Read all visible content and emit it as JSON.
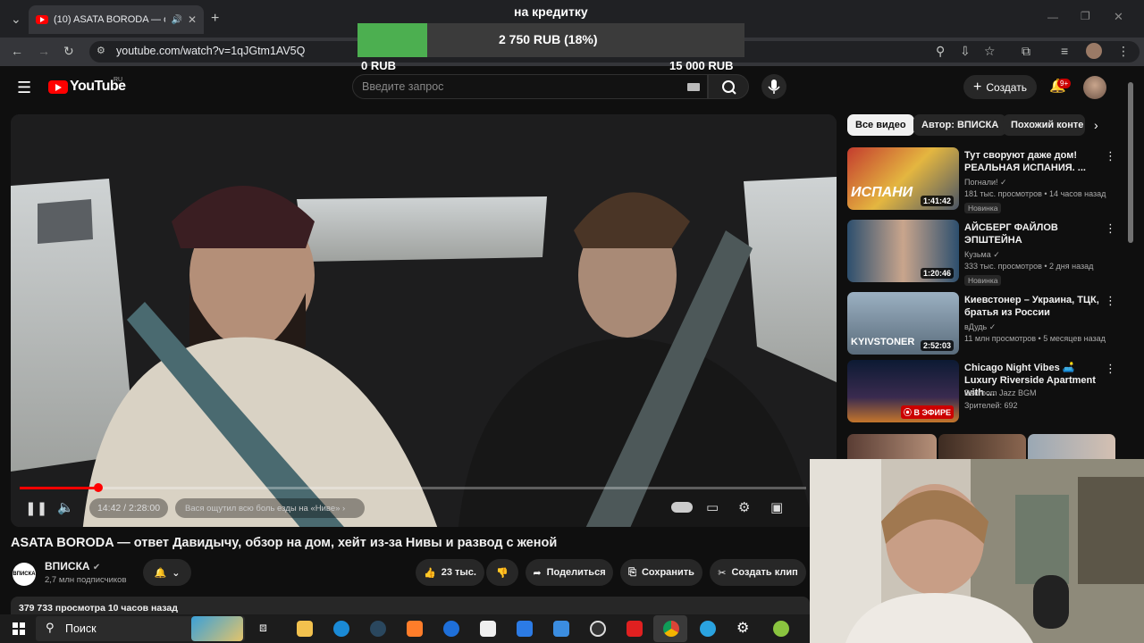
{
  "browser": {
    "tab_title": "(10) ASATA BORODA — от",
    "url": "youtube.com/watch?v=1qJGtm1AV5Q"
  },
  "credit_overlay": {
    "title": "на кредитку",
    "value_label": "2 750 RUB (18%)",
    "min_label": "0 RUB",
    "max_label": "15 000 RUB",
    "progress_fraction": 0.18,
    "fill_color": "#4caf50"
  },
  "youtube": {
    "logo_text": "YouTube",
    "logo_region": "RU",
    "search_placeholder": "Введите запрос",
    "create_label": "Создать",
    "notif_count": "9+"
  },
  "player": {
    "time": "14:42 / 2:28:00",
    "chapter": "Вася ощутил всю боль езды на «Ниве»",
    "progress_fraction": 0.1
  },
  "video": {
    "title": "ASATA BORODA — ответ Давидычу, обзор на дом, хейт из-за Нивы и развод с женой",
    "channel_logo": "ВПИСКА",
    "channel_name": "ВПИСКА",
    "subscribers": "2,7 млн подписчиков",
    "likes": "23 тыс.",
    "share_label": "Поделиться",
    "save_label": "Сохранить",
    "clip_label": "Создать клип",
    "meta": "379 733 просмотра  10 часов назад"
  },
  "sidebar": {
    "chips": [
      "Все видео",
      "Автор: ВПИСКА",
      "Похожий конте"
    ],
    "recommendations": [
      {
        "title": "Тут своруют даже дом! РЕАЛЬНАЯ ИСПАНИЯ. ...",
        "channel": "Погнали! ✓",
        "stats": "181 тыс. просмотров • 14 часов назад",
        "badge": "Новинка",
        "duration": "1:41:42",
        "thumb_text": "ИСПАНИ"
      },
      {
        "title": "АЙСБЕРГ ФАЙЛОВ ЭПШТЕЙНА",
        "channel": "Кузьма ✓",
        "stats": "333 тыс. просмотров • 2 дня назад",
        "badge": "Новинка",
        "duration": "1:20:46"
      },
      {
        "title": "Киевстонер – Украина, ТЦК, братья из России",
        "channel": "вДудь ✓",
        "stats": "11 млн просмотров • 5 месяцев назад",
        "duration": "2:52:03",
        "thumb_text": "KYIVSTONER"
      },
      {
        "title": "Chicago Night Vibes 🛋️ Luxury Riverside Apartment with ...",
        "channel": "Bedroom Jazz BGM",
        "stats": "Зрителей: 692",
        "live": "В ЭФИРЕ"
      }
    ]
  },
  "taskbar": {
    "search_label": "Поиск"
  }
}
